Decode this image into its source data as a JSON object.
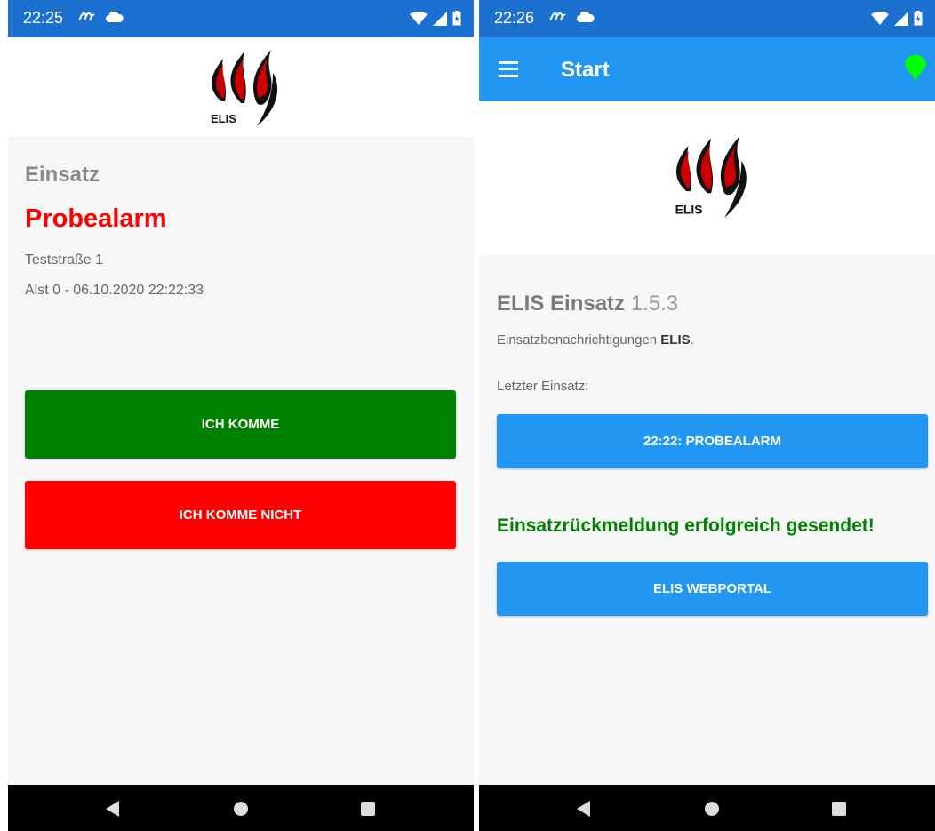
{
  "left": {
    "status": {
      "time": "22:25"
    },
    "section_label": "Einsatz",
    "alarm_title": "Probealarm",
    "address": "Teststraße 1",
    "alarm_info": "Alst 0 - 06.10.2020 22:22:33",
    "logo_text": "ELIS",
    "buttons": {
      "coming": {
        "label": "ICH KOMME",
        "color": "#008000"
      },
      "not_coming": {
        "label": "ICH KOMME NICHT",
        "color": "#ff0000"
      }
    }
  },
  "right": {
    "status": {
      "time": "22:26"
    },
    "appbar": {
      "title": "Start",
      "pin_color": "#00ff00"
    },
    "logo_text": "ELIS",
    "app_name": "ELIS Einsatz",
    "version": "1.5.3",
    "description_prefix": "Einsatzbenachrichtigungen ",
    "description_bold": "ELIS",
    "description_suffix": ".",
    "last_incident_label": "Letzter Einsatz:",
    "last_incident_button": "22:22: PROBEALARM",
    "success_message": "Einsatzrückmeldung erfolgreich gesendet!",
    "webportal_button": "ELIS WEBPORTAL",
    "accent_color": "#2196f3"
  },
  "icons": {
    "status_left": [
      "app-notification-icon",
      "cloud-icon"
    ],
    "status_right": [
      "wifi-icon",
      "signal-icon",
      "battery-icon"
    ],
    "nav": [
      "back-icon",
      "home-icon",
      "recents-icon"
    ]
  }
}
